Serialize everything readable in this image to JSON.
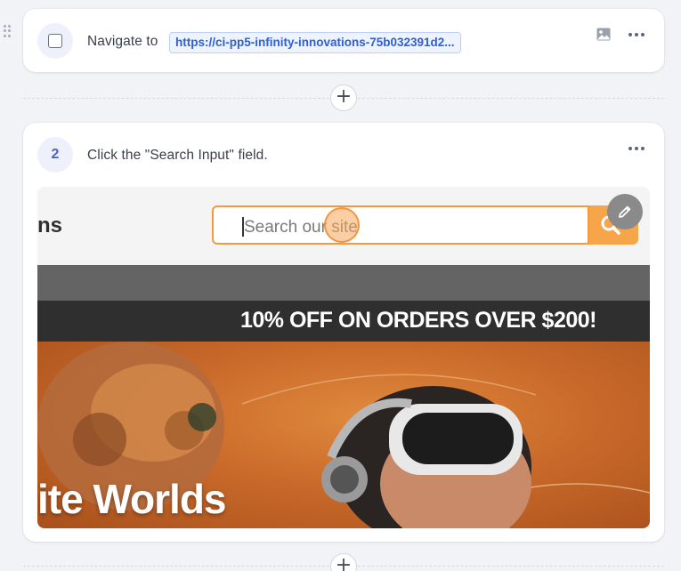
{
  "steps": [
    {
      "marker": "checkbox",
      "action_text": "Navigate to",
      "url_text": "https://ci-pp5-infinity-innovations-75b032391d2..."
    },
    {
      "number": "2",
      "action_text": "Click the \"Search Input\" field."
    }
  ],
  "screenshot": {
    "brand_fragment": "ns",
    "search_placeholder": "Search our site",
    "promo_text": "10% OFF ON ORDERS OVER $200!",
    "hero_text": "ite Worlds"
  },
  "icons": {
    "step1_image": "image-icon",
    "step1_more": "more-icon",
    "step2_more": "more-icon",
    "edit": "pencil-icon",
    "add": "plus-icon",
    "search": "search-icon",
    "drag": "drag-handle-icon"
  },
  "colors": {
    "accent": "#4b5fd0",
    "url_chip_text": "#2f5fd0",
    "search_border": "#f29a3f",
    "search_button": "#f7a54b",
    "promo_band": "#2f2f2f"
  }
}
